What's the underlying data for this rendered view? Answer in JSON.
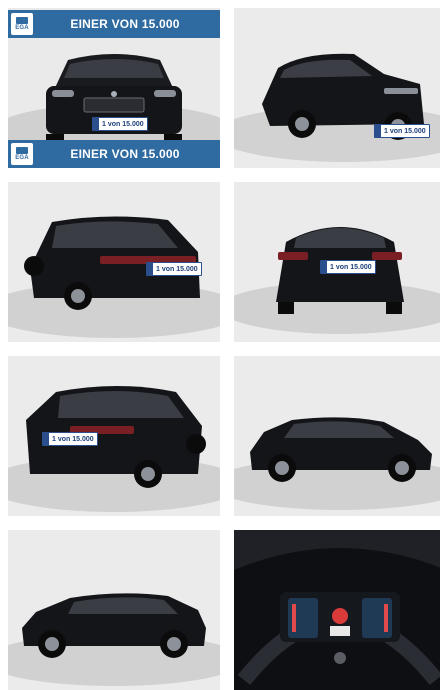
{
  "gallery": {
    "banner_text": "EINER VON 15.000",
    "logo_text": "EGA",
    "plate_text": "1 von 15.000",
    "colors": {
      "banner": "#2f6aa0",
      "car": "#141518",
      "backdrop": "#e9e9e9",
      "floor": "#cfcfcf"
    },
    "photos": [
      {
        "view": "front"
      },
      {
        "view": "front-three-quarter"
      },
      {
        "view": "rear-three-quarter-left"
      },
      {
        "view": "rear"
      },
      {
        "view": "rear-three-quarter-right"
      },
      {
        "view": "side-right"
      },
      {
        "view": "side-left"
      },
      {
        "view": "instrument-cluster"
      }
    ]
  }
}
